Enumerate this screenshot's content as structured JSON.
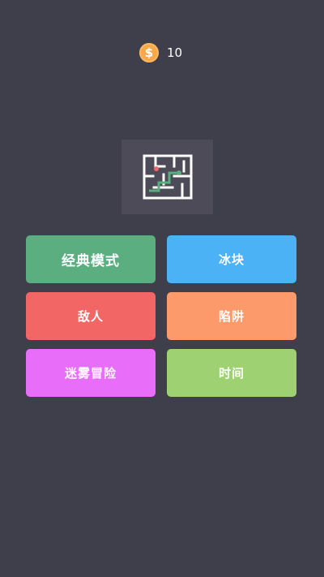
{
  "header": {
    "coin_icon": "dollar-coin-icon",
    "coin_symbol": "$",
    "coin_count": "10"
  },
  "logo": {
    "icon": "maze-icon"
  },
  "modes": [
    {
      "label": "经典模式",
      "color": "#5aae7f"
    },
    {
      "label": "冰块",
      "color": "#4cb2f6"
    },
    {
      "label": "敌人",
      "color": "#f26766"
    },
    {
      "label": "陷阱",
      "color": "#fc9a6b"
    },
    {
      "label": "迷雾冒险",
      "color": "#e86ef9"
    },
    {
      "label": "时间",
      "color": "#9dd171"
    }
  ]
}
